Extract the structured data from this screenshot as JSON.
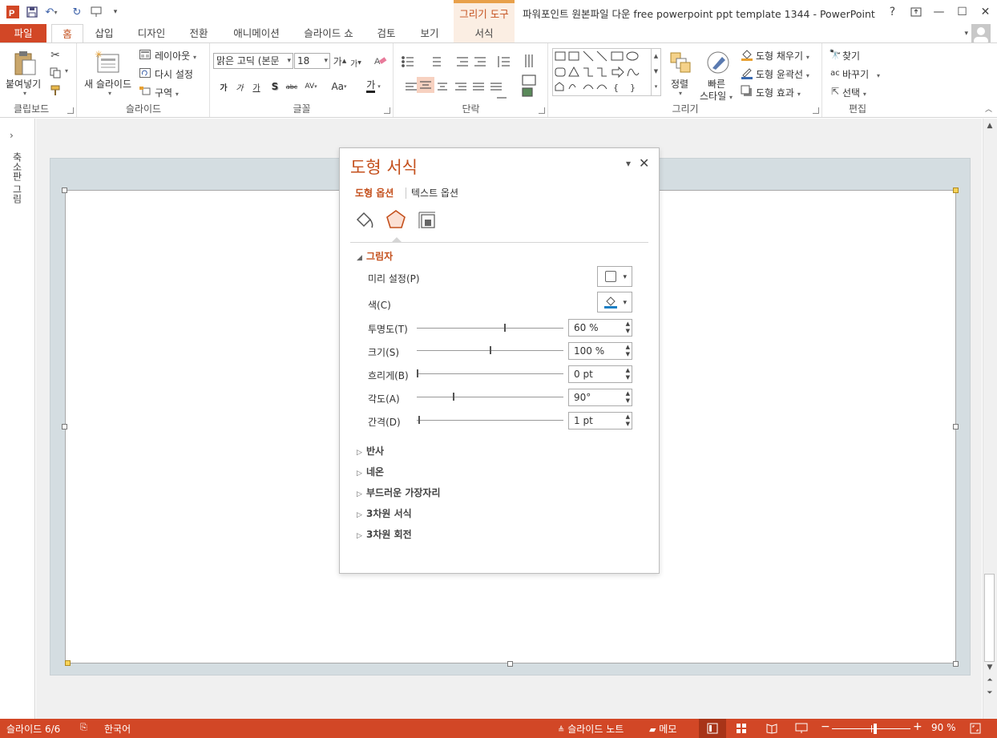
{
  "window": {
    "title": "파워포인트 원본파일 다운 free powerpoint ppt template 1344 - PowerPoint",
    "context_tab_group": "그리기 도구",
    "help": "?",
    "controls": [
      "restore-ribbon",
      "minimize",
      "maximize",
      "close"
    ]
  },
  "tabs": [
    {
      "label": "파일"
    },
    {
      "label": "홈"
    },
    {
      "label": "삽입"
    },
    {
      "label": "디자인"
    },
    {
      "label": "전환"
    },
    {
      "label": "애니메이션"
    },
    {
      "label": "슬라이드 쇼"
    },
    {
      "label": "검토"
    },
    {
      "label": "보기"
    },
    {
      "label": "서식"
    }
  ],
  "ribbon": {
    "clipboard": {
      "label": "클립보드",
      "paste": "붙여넣기"
    },
    "slides": {
      "label": "슬라이드",
      "new_slide": "새 슬라이드",
      "layout": "레이아웃",
      "reset": "다시 설정",
      "section": "구역"
    },
    "font": {
      "label": "글꼴",
      "font_name": "맑은 고딕 (본문",
      "font_size": "18",
      "bold": "가",
      "italic": "가",
      "underline": "가",
      "shadow": "S",
      "strike": "abc",
      "spacing": "AV",
      "case": "Aa",
      "color": "가"
    },
    "paragraph": {
      "label": "단락"
    },
    "drawing": {
      "label": "그리기",
      "arrange": "정렬",
      "quick_styles_1": "빠른",
      "quick_styles_2": "스타일",
      "shape_fill": "도형 채우기",
      "shape_outline": "도형 윤곽선",
      "shape_effects": "도형 효과"
    },
    "editing": {
      "label": "편집",
      "find": "찾기",
      "replace": "바꾸기",
      "select": "선택"
    }
  },
  "thumbnails": {
    "label": "축소판 그림"
  },
  "format_pane": {
    "title": "도형 서식",
    "tab_shape": "도형 옵션",
    "tab_text": "텍스트 옵션",
    "section_shadow": "그림자",
    "props": [
      {
        "label": "미리 설정(P)"
      },
      {
        "label": "색(C)"
      },
      {
        "label": "투명도(T)",
        "value": "60 %",
        "level": 0.6
      },
      {
        "label": "크기(S)",
        "value": "100 %",
        "level": 0.5
      },
      {
        "label": "흐리게(B)",
        "value": "0 pt",
        "level": 0.0
      },
      {
        "label": "각도(A)",
        "value": "90°",
        "level": 0.25
      },
      {
        "label": "간격(D)",
        "value": "1 pt",
        "level": 0.01
      }
    ],
    "sections": [
      "반사",
      "네온",
      "부드러운 가장자리",
      "3차원 서식",
      "3차원 회전"
    ]
  },
  "status": {
    "slide": "슬라이드 6/6",
    "language": "한국어",
    "notes": "슬라이드 노트",
    "comments": "메모",
    "zoom": "90 %",
    "zoom_level": 0.55
  }
}
